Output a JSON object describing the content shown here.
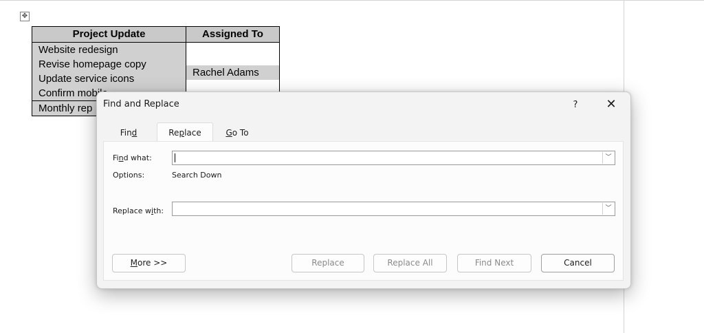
{
  "document": {
    "table": {
      "headers": [
        "Project Update",
        "Assigned To"
      ],
      "tasks": [
        "Website redesign",
        "Revise homepage copy",
        "Update service icons",
        "Confirm mobile",
        "Monthly rep"
      ],
      "assignee": "Rachel Adams"
    }
  },
  "dialog": {
    "title": "Find and Replace",
    "help": "?",
    "close": "✕",
    "tabs": [
      {
        "pre": "Fin",
        "key": "d",
        "post": ""
      },
      {
        "pre": "Re",
        "key": "p",
        "post": "lace"
      },
      {
        "pre": "",
        "key": "G",
        "post": "o To"
      }
    ],
    "active_tab": "Replace",
    "find_label": {
      "pre": "Fi",
      "key": "n",
      "post": "d what:"
    },
    "find_value": "",
    "options_label": "Options:",
    "options_value": "Search Down",
    "replace_label": {
      "pre": "Replace w",
      "key": "i",
      "post": "th:"
    },
    "replace_value": "",
    "buttons": {
      "more": {
        "pre": "",
        "key": "M",
        "post": "ore >>"
      },
      "replace": "Replace",
      "replace_all": "Replace All",
      "find_next": "Find Next",
      "cancel": "Cancel"
    }
  }
}
